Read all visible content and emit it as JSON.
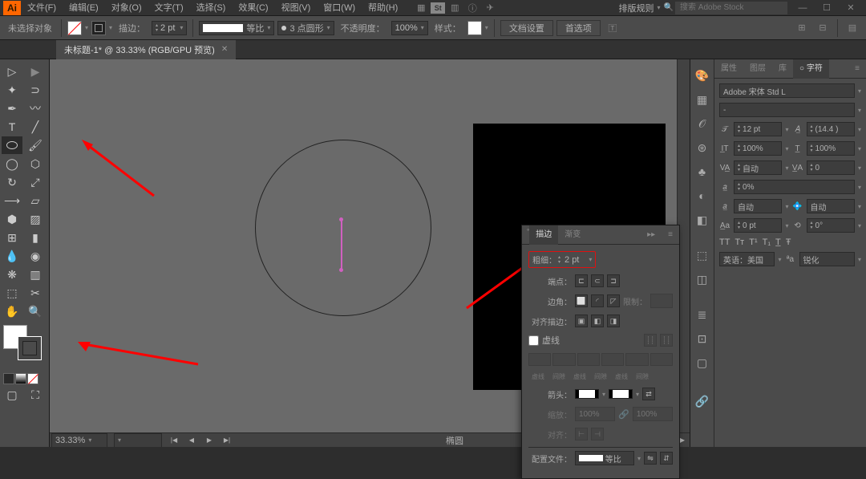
{
  "app": {
    "logo": "Ai"
  },
  "menu": [
    "文件(F)",
    "编辑(E)",
    "对象(O)",
    "文字(T)",
    "选择(S)",
    "效果(C)",
    "视图(V)",
    "窗口(W)",
    "帮助(H)"
  ],
  "titlebar": {
    "layout_label": "排版规则",
    "search_placeholder": "搜索 Adobe Stock"
  },
  "controlbar": {
    "no_selection": "未选择对象",
    "stroke_label": "描边：",
    "stroke_val": "2 pt",
    "scale_label": "等比",
    "brush_label": "3 点圆形",
    "opacity_label": "不透明度：",
    "opacity_val": "100%",
    "style_label": "样式：",
    "doc_setup": "文档设置",
    "prefs": "首选项"
  },
  "tab": {
    "title": "未标题-1* @ 33.33% (RGB/GPU 预览)"
  },
  "status": {
    "zoom": "33.33%",
    "tool": "椭圆"
  },
  "stroke_panel": {
    "tabs": [
      "描边",
      "渐变"
    ],
    "weight_label": "粗细：",
    "weight_val": "2 pt",
    "caps_label": "端点：",
    "corners_label": "边角：",
    "limit_label": "限制：",
    "align_label": "对齐描边：",
    "dashed": "虚线",
    "dash_headers": [
      "虚线",
      "间隙",
      "虚线",
      "间隙",
      "虚线",
      "间隙"
    ],
    "arrows_label": "箭头：",
    "scale_label": "缩放：",
    "scale_val": "100%",
    "align2_label": "对齐：",
    "profile_label": "配置文件：",
    "profile_val": "等比"
  },
  "char_panel": {
    "tabs": [
      "属性",
      "图层",
      "库",
      "字符"
    ],
    "font": "Adobe 宋体 Std L",
    "style": "-",
    "size": "12 pt",
    "leading": "(14.4 )",
    "vscale": "100%",
    "hscale": "100%",
    "tracking": "自动",
    "kerning": "0",
    "baseline_opt": "0%",
    "auto": "自动",
    "baseline": "0 pt",
    "rotation": "0°",
    "lang": "英语：美国",
    "antialias": "锐化"
  }
}
